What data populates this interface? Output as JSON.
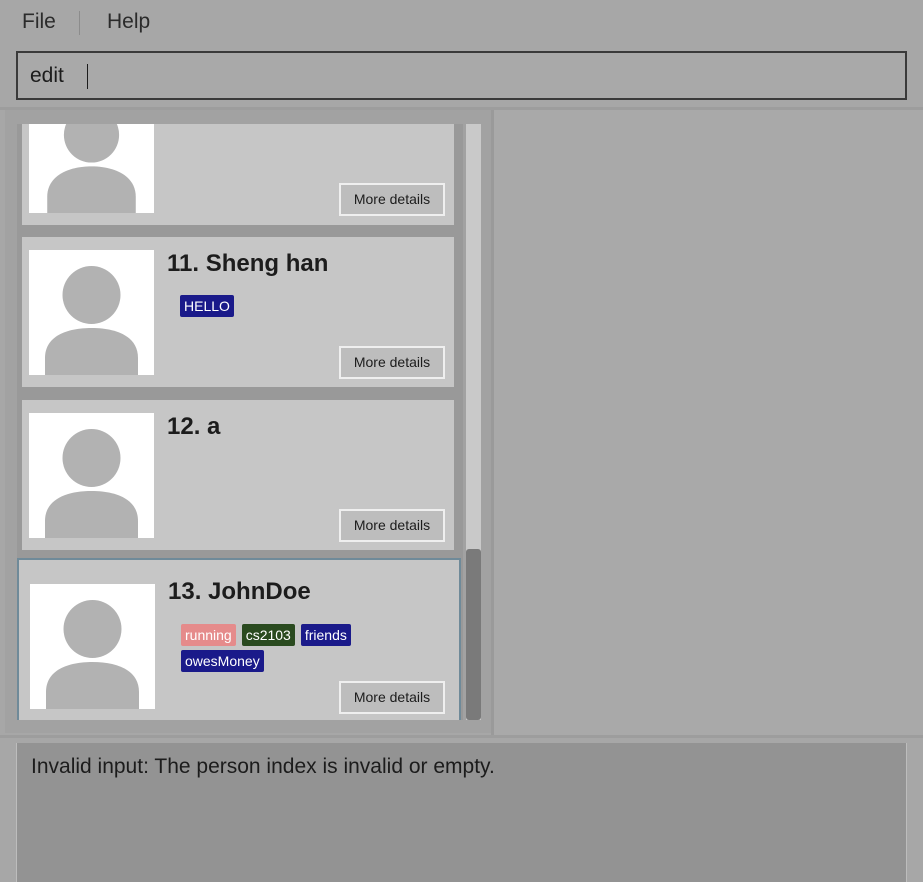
{
  "menu": {
    "file": "File",
    "help": "Help"
  },
  "command": {
    "value": "edit"
  },
  "persons": [
    {
      "index_name": "",
      "tags": [],
      "details_label": "More details"
    },
    {
      "index_name": "11. Sheng han",
      "tags": [
        {
          "label": "HELLO",
          "color": "#1a1a8a"
        }
      ],
      "details_label": "More details"
    },
    {
      "index_name": "12. a",
      "tags": [],
      "details_label": "More details"
    },
    {
      "index_name": "13. JohnDoe",
      "tags": [
        {
          "label": "running",
          "color": "#e58b8b"
        },
        {
          "label": "cs2103",
          "color": "#2a4a1f"
        },
        {
          "label": "friends",
          "color": "#1a1a8a"
        },
        {
          "label": "owesMoney",
          "color": "#1a1a8a"
        }
      ],
      "details_label": "More details"
    }
  ],
  "result": {
    "message": "Invalid input: The person index is invalid or empty."
  },
  "colors": {
    "selected_border": "#6f8a99",
    "scroll_thumb": "#7a7a7a"
  }
}
